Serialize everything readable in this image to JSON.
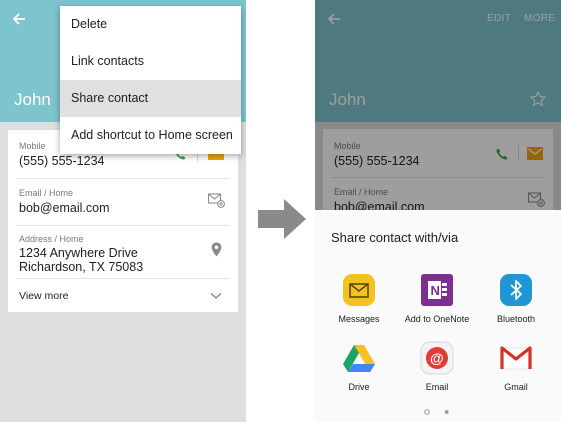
{
  "left_screen": {
    "contact_name": "John",
    "menu": {
      "items": [
        {
          "label": "Delete"
        },
        {
          "label": "Link contacts"
        },
        {
          "label": "Share contact"
        },
        {
          "label": "Add shortcut to Home screen"
        }
      ],
      "highlighted": "Share contact"
    },
    "card": {
      "mobile_label": "Mobile",
      "mobile_value": "(555) 555-1234",
      "email_label": "Email / Home",
      "email_value": "bob@email.com",
      "address_label": "Address / Home",
      "address_line1": "1234 Anywhere Drive",
      "address_line2": "Richardson, TX  75083",
      "view_more": "View more"
    }
  },
  "right_screen": {
    "contact_name": "John",
    "actions": {
      "edit": "EDIT",
      "more": "MORE"
    },
    "card": {
      "mobile_label": "Mobile",
      "mobile_value": "(555) 555-1234",
      "email_label": "Email / Home",
      "email_value": "bob@email.com"
    },
    "share_sheet": {
      "title": "Share contact with/via",
      "apps": [
        {
          "label": "Messages",
          "icon": "messages-icon"
        },
        {
          "label": "Add to OneNote",
          "icon": "onenote-icon"
        },
        {
          "label": "Bluetooth",
          "icon": "bluetooth-icon"
        },
        {
          "label": "Drive",
          "icon": "drive-icon"
        },
        {
          "label": "Email",
          "icon": "email-icon"
        },
        {
          "label": "Gmail",
          "icon": "gmail-icon"
        }
      ]
    }
  },
  "colors": {
    "header": "#7ec4cc",
    "call_green": "#43a047",
    "message_orange": "#f4a30c",
    "arrow_gray": "#8a8a8a"
  }
}
